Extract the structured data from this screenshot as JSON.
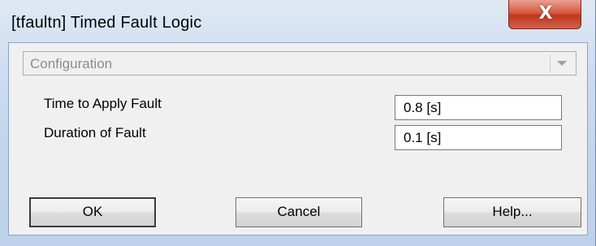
{
  "window": {
    "title": "[tfaultn] Timed Fault Logic",
    "close_glyph": "X"
  },
  "configuration": {
    "selected": "Configuration",
    "arrow_icon": "chevron-down-icon"
  },
  "fields": [
    {
      "label": "Time to Apply Fault",
      "value": "0.8 [s]"
    },
    {
      "label": "Duration of Fault",
      "value": "0.1 [s]"
    }
  ],
  "buttons": {
    "ok": "OK",
    "cancel": "Cancel",
    "help": "Help..."
  }
}
